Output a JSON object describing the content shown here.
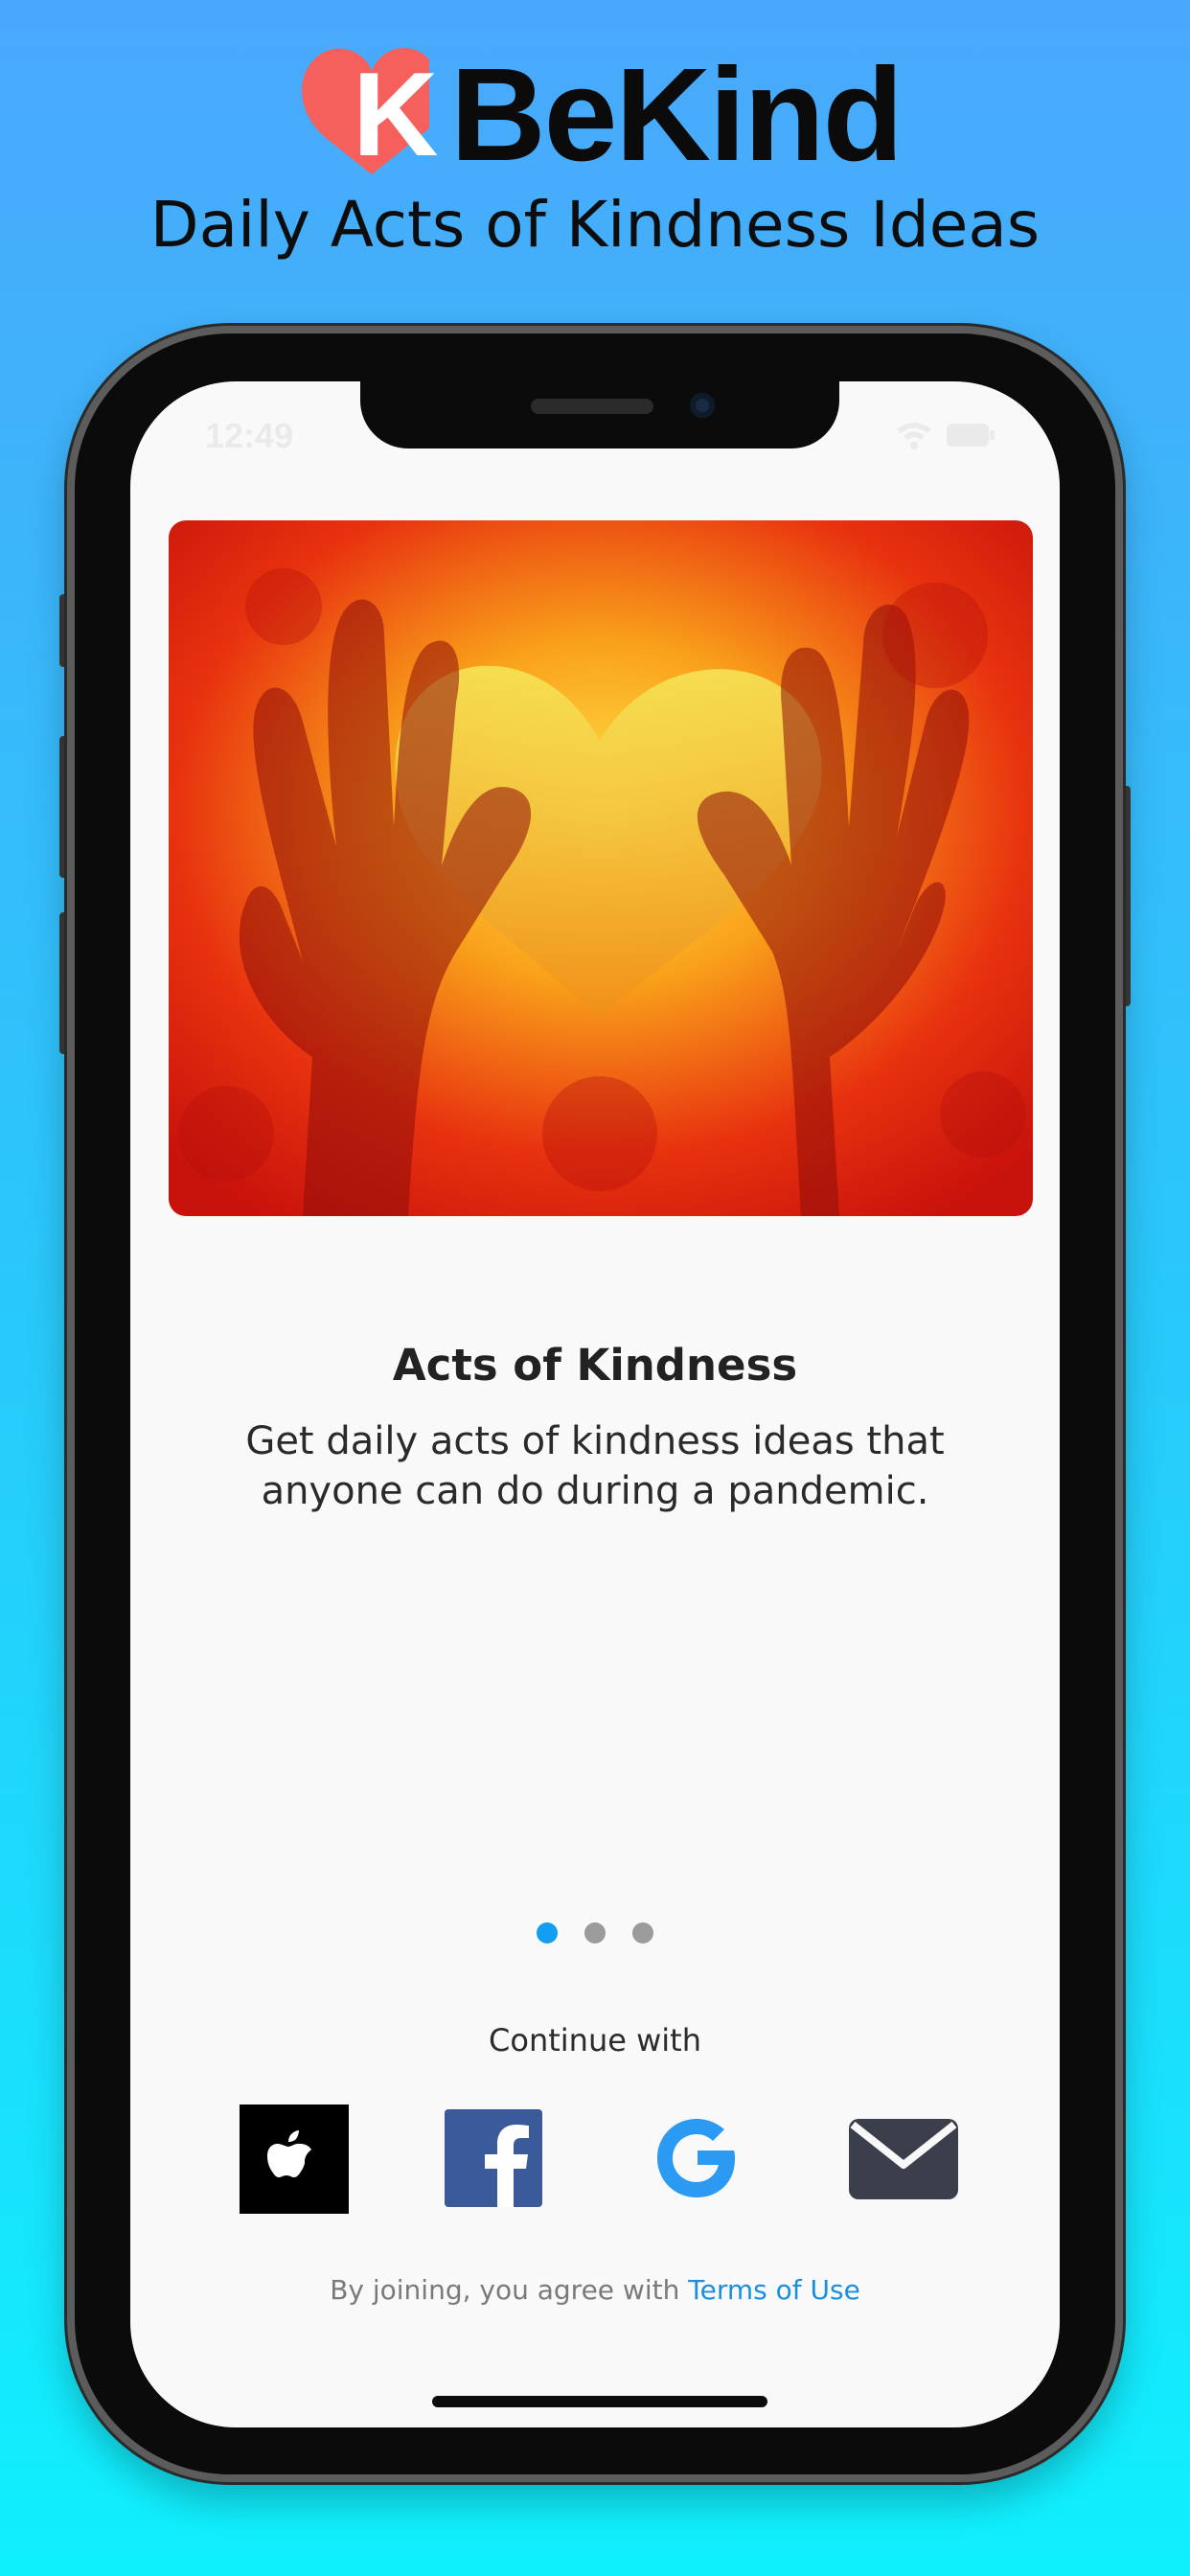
{
  "brand": {
    "name": "BeKind",
    "logo_letter": "K",
    "logo_color": "#f5605d",
    "tagline": "Daily Acts of Kindness Ideas"
  },
  "status_bar": {
    "time": "12:49",
    "icons": [
      "wifi-icon",
      "battery-icon"
    ]
  },
  "onboarding": {
    "card_title": "Acts of Kindness",
    "card_description": "Get daily acts of kindness ideas that anyone can do during a pandemic.",
    "page_count": 3,
    "active_page": 1,
    "accent_color": "#149ef2"
  },
  "auth": {
    "continue_label": "Continue with",
    "providers": [
      {
        "id": "apple",
        "icon": "apple-icon"
      },
      {
        "id": "facebook",
        "icon": "facebook-icon"
      },
      {
        "id": "google",
        "icon": "google-icon"
      },
      {
        "id": "email",
        "icon": "mail-icon"
      }
    ],
    "terms_prefix": "By joining, you agree with",
    "terms_link": "Terms of Use"
  }
}
